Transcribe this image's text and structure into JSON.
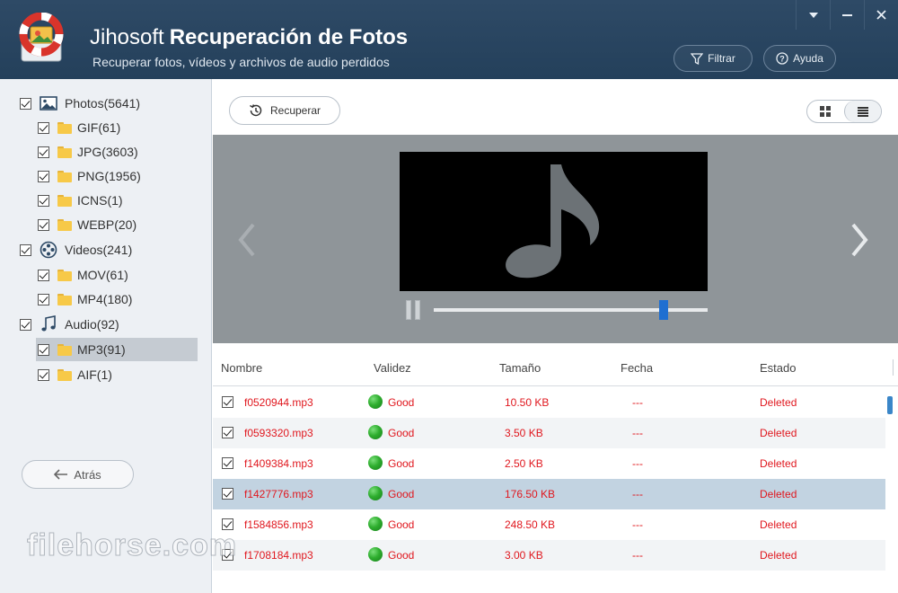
{
  "app": {
    "brand": "Jihosoft",
    "product": "Recuperación de Fotos",
    "subtitle": "Recuperar fotos, vídeos y archivos de audio perdidos",
    "filter_label": "Filtrar",
    "help_label": "Ayuda"
  },
  "sidebar": {
    "categories": [
      {
        "label": "Photos(5641)",
        "icon": "image-icon",
        "checked": true,
        "children": [
          {
            "label": "GIF(61)",
            "checked": true
          },
          {
            "label": "JPG(3603)",
            "checked": true
          },
          {
            "label": "PNG(1956)",
            "checked": true
          },
          {
            "label": "ICNS(1)",
            "checked": true
          },
          {
            "label": "WEBP(20)",
            "checked": true
          }
        ]
      },
      {
        "label": "Videos(241)",
        "icon": "film-reel-icon",
        "checked": true,
        "children": [
          {
            "label": "MOV(61)",
            "checked": true
          },
          {
            "label": "MP4(180)",
            "checked": true
          }
        ]
      },
      {
        "label": "Audio(92)",
        "icon": "music-note-icon",
        "checked": true,
        "children": [
          {
            "label": "MP3(91)",
            "checked": true,
            "selected": true
          },
          {
            "label": "AIF(1)",
            "checked": true
          }
        ]
      }
    ],
    "back_label": "Atrás"
  },
  "toolbar": {
    "recover_label": "Recuperar",
    "view_mode": "list"
  },
  "player": {
    "media_icon": "music-note-icon",
    "state": "paused",
    "progress": 0.84
  },
  "table": {
    "columns": [
      "Nombre",
      "Validez",
      "Tamaño",
      "Fecha",
      "Estado"
    ],
    "rows": [
      {
        "name": "f0520944.mp3",
        "validity": "Good",
        "size": "10.50 KB",
        "date": "---",
        "status": "Deleted",
        "checked": true
      },
      {
        "name": "f0593320.mp3",
        "validity": "Good",
        "size": "3.50 KB",
        "date": "---",
        "status": "Deleted",
        "checked": true
      },
      {
        "name": "f1409384.mp3",
        "validity": "Good",
        "size": "2.50 KB",
        "date": "---",
        "status": "Deleted",
        "checked": true
      },
      {
        "name": "f1427776.mp3",
        "validity": "Good",
        "size": "176.50 KB",
        "date": "---",
        "status": "Deleted",
        "checked": true,
        "selected": true
      },
      {
        "name": "f1584856.mp3",
        "validity": "Good",
        "size": "248.50 KB",
        "date": "---",
        "status": "Deleted",
        "checked": true
      },
      {
        "name": "f1708184.mp3",
        "validity": "Good",
        "size": "3.00 KB",
        "date": "---",
        "status": "Deleted",
        "checked": true
      }
    ]
  },
  "watermark": "filehorse.com",
  "colors": {
    "header_bg": "#24405b",
    "row_text": "#e0171e",
    "selected_row": "#c2d3e1",
    "good_dot": "#2fae2f",
    "seek_thumb": "#1f6fd1"
  }
}
